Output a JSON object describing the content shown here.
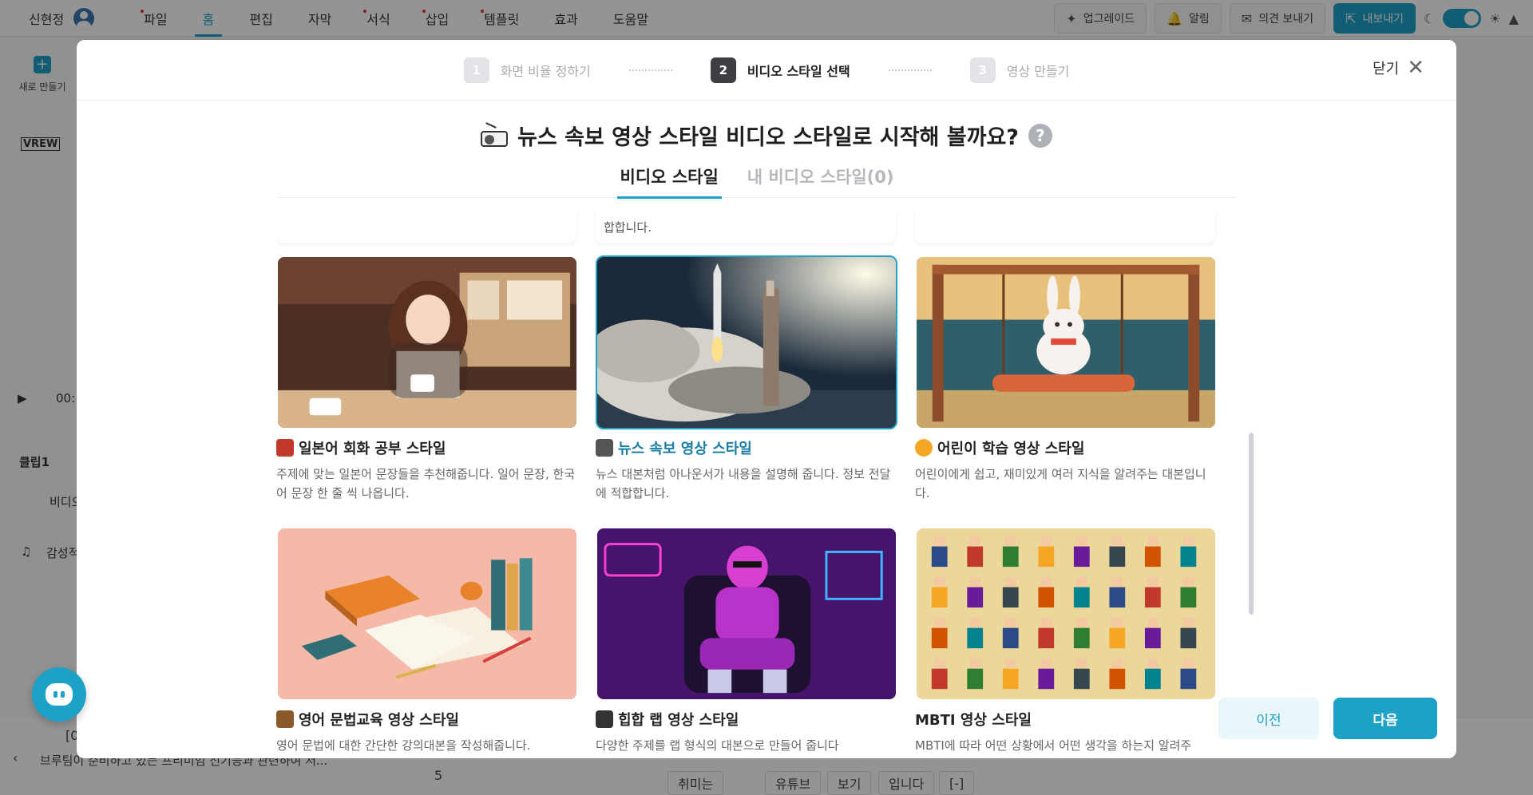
{
  "topbar": {
    "user_name": "신현정",
    "menu": [
      {
        "label": "파일",
        "dot": true
      },
      {
        "label": "홈",
        "dot": false,
        "active": true
      },
      {
        "label": "편집",
        "dot": false
      },
      {
        "label": "자막",
        "dot": false
      },
      {
        "label": "서식",
        "dot": true
      },
      {
        "label": "삽입",
        "dot": true
      },
      {
        "label": "템플릿",
        "dot": true
      },
      {
        "label": "효과",
        "dot": false
      },
      {
        "label": "도움말",
        "dot": false
      }
    ],
    "upgrade_label": "업그레이드",
    "alarm_label": "알림",
    "feedback_label": "의견 보내기",
    "export_label": "내보내기"
  },
  "background": {
    "new_label": "새로 만들기",
    "logo": "VREW",
    "time": "00:",
    "clip_label": "클립1",
    "video_label": "비디오",
    "music_label": "감성적",
    "bottom_text": "브루팀이 준비하고 있는 프리미엄 신기능과 관련하여 저...",
    "bottom_label": "[0",
    "page_number": "5",
    "chips": [
      "취미는",
      "유튜브",
      "보기",
      "입니다",
      "[-]"
    ]
  },
  "modal": {
    "steps": [
      {
        "num": "1",
        "label": "화면 비율 정하기"
      },
      {
        "num": "2",
        "label": "비디오 스타일 선택"
      },
      {
        "num": "3",
        "label": "영상 만들기"
      }
    ],
    "close_label": "닫기",
    "title": "뉴스 속보 영상 스타일 비디오 스타일로 시작해 볼까요?",
    "tabs": [
      "비디오 스타일",
      "내 비디오 스타일(0)"
    ],
    "prev_row_text": "합합니다.",
    "cards": [
      {
        "title": "일본어 회화 공부 스타일",
        "desc": "주제에 맞는 일본어 문장들을 추천해줍니다. 일어 문장, 한국어 문장 한 줄 씩 나옵니다.",
        "emoji_color": "#c0392b"
      },
      {
        "title": "뉴스 속보 영상 스타일",
        "desc": "뉴스 대본처럼 아나운서가 내용을 설명해 줍니다. 정보 전달에 적합합니다.",
        "emoji_color": "#555555"
      },
      {
        "title": "어린이 학습 영상 스타일",
        "desc": "어린이에게 쉽고, 재미있게 여러 지식을 알려주는 대본입니다.",
        "emoji_color": "#f5a623"
      },
      {
        "title": "영어 문법교육 영상 스타일",
        "desc": "영어 문법에 대한 간단한 강의대본을 작성해줍니다.",
        "emoji_color": "#8b5a2b"
      },
      {
        "title": "힙합 랩 영상 스타일",
        "desc": "다양한 주제를 랩 형식의 대본으로 만들어 줍니다",
        "emoji_color": "#333333"
      },
      {
        "title": "MBTI 영상 스타일",
        "desc": "MBTI에 따라 어떤 상황에서 어떤 생각을 하는지 알려주",
        "emoji_color": ""
      }
    ],
    "prev_button": "이전",
    "next_button": "다음"
  },
  "colors": {
    "accent": "#1ea1c6"
  }
}
